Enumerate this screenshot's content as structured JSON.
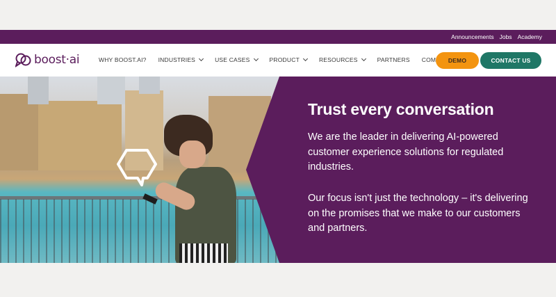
{
  "topbar": {
    "links": [
      "Announcements",
      "Jobs",
      "Academy"
    ]
  },
  "logo": {
    "text": "boost·ai"
  },
  "nav": {
    "items": [
      {
        "label": "WHY BOOST.AI?",
        "dropdown": false
      },
      {
        "label": "INDUSTRIES",
        "dropdown": true
      },
      {
        "label": "USE CASES",
        "dropdown": true
      },
      {
        "label": "PRODUCT",
        "dropdown": true
      },
      {
        "label": "RESOURCES",
        "dropdown": true
      },
      {
        "label": "PARTNERS",
        "dropdown": false
      },
      {
        "label": "COMPANY",
        "dropdown": true
      }
    ],
    "demo_label": "DEMO",
    "contact_label": "CONTACT US"
  },
  "hero": {
    "title": "Trust every conversation",
    "paragraph1": "We are the leader in delivering AI-powered customer experience solutions for regulated industries.",
    "paragraph2": "Our focus isn't just the technology – it's delivering on the promises that we make to our customers and partners."
  },
  "colors": {
    "brand_purple": "#5b1d5c",
    "demo_orange": "#f39410",
    "contact_green": "#1f7766"
  }
}
